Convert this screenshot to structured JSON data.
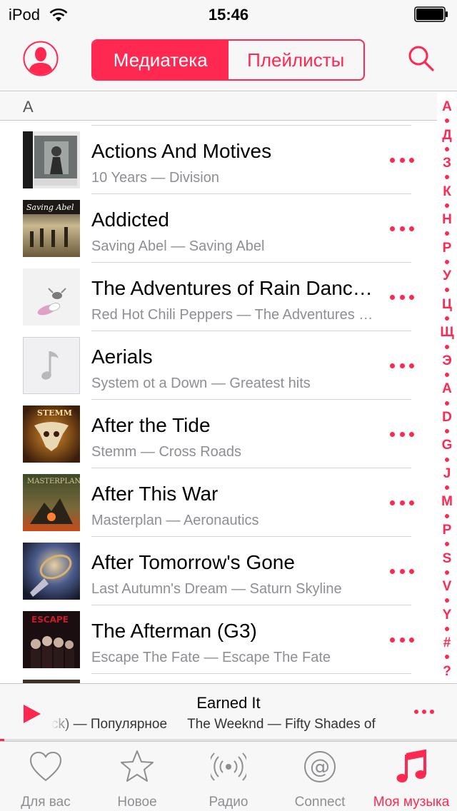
{
  "status": {
    "carrier": "iPod",
    "time": "15:46"
  },
  "nav": {
    "segments": [
      {
        "label": "Медиатека",
        "active": true
      },
      {
        "label": "Плейлисты",
        "active": false
      }
    ]
  },
  "section": {
    "letter": "А"
  },
  "songs": [
    {
      "title": "Actions And Motives",
      "subtitle": "10 Years — Division",
      "art": "art-division"
    },
    {
      "title": "Addicted",
      "subtitle": "Saving Abel — Saving Abel",
      "art": "art-saving-abel"
    },
    {
      "title": "The Adventures of Rain Dance Maggie",
      "subtitle": "Red Hot Chili Peppers — The Adventures of Rain Dance Maggie",
      "art": "art-rhcp"
    },
    {
      "title": "Aerials",
      "subtitle": "System ot a Down — Greatest hits",
      "art": "music-note-placeholder"
    },
    {
      "title": "After the Tide",
      "subtitle": "Stemm — Cross Roads",
      "art": "art-stemm"
    },
    {
      "title": "After This War",
      "subtitle": "Masterplan — Aeronautics",
      "art": "art-masterplan"
    },
    {
      "title": "After Tomorrow's Gone",
      "subtitle": "Last Autumn's Dream — Saturn Skyline",
      "art": "art-last-autumn"
    },
    {
      "title": "The Afterman (G3)",
      "subtitle": "Escape The Fate — Escape The Fate",
      "art": "art-escape-the-fate"
    }
  ],
  "alpha_index": [
    "А",
    "Д",
    "З",
    "К",
    "Н",
    "Р",
    "У",
    "Ц",
    "Щ",
    "Э",
    "A",
    "D",
    "G",
    "J",
    "M",
    "P",
    "S",
    "V",
    "Y",
    "#",
    "?"
  ],
  "now_playing": {
    "title": "Earned It",
    "subtitle_left": "ck) — Популярное",
    "subtitle_right": "The Weeknd — Fifty Shades of",
    "progress": 0.01
  },
  "tabs": [
    {
      "label": "Для вас",
      "icon": "heart-icon",
      "active": false
    },
    {
      "label": "Новое",
      "icon": "star-icon",
      "active": false
    },
    {
      "label": "Радио",
      "icon": "radio-icon",
      "active": false
    },
    {
      "label": "Connect",
      "icon": "at-icon",
      "active": false
    },
    {
      "label": "Моя музыка",
      "icon": "music-note-icon",
      "active": true
    }
  ],
  "colors": {
    "accent": "#fe2851",
    "secondary_text": "#8e8e93",
    "bar_bg": "#f7f7f7"
  }
}
